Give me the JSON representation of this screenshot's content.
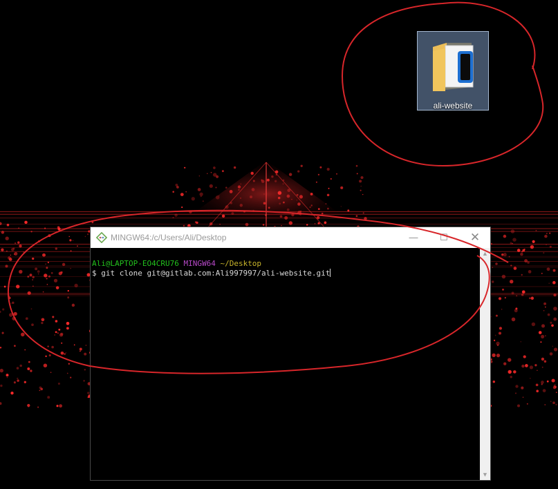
{
  "desktop": {
    "icon": {
      "label": "ali-website",
      "icon": "folder-icon"
    }
  },
  "terminal": {
    "title": "MINGW64:/c/Users/Ali/Desktop",
    "window_buttons": {
      "minimize": "—",
      "maximize": "☐",
      "close": "✕"
    },
    "prompt": {
      "user_host": "Ali@LAPTOP-EO4CRU76",
      "system": "MINGW64",
      "path": "~/Desktop"
    },
    "command": "$ git clone git@gitlab.com:Ali997997/ali-website.git",
    "scroll": {
      "up": "▲",
      "down": "▼"
    }
  },
  "colors": {
    "prompt_user": "#22c11d",
    "prompt_system": "#b548c6",
    "prompt_path": "#c8b52b",
    "annotation": "#d8262a",
    "wallpaper_glow": "#ff2a2a"
  }
}
